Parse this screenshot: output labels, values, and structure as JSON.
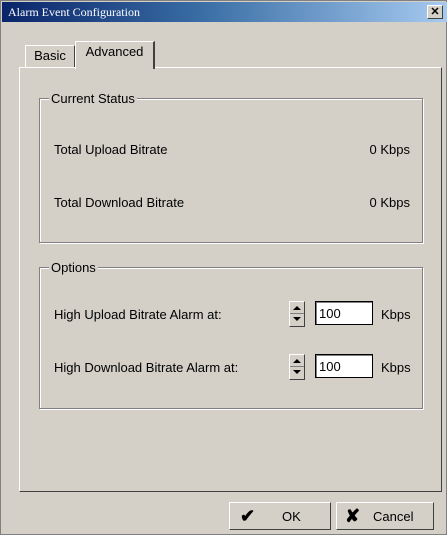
{
  "window": {
    "title": "Alarm Event Configuration",
    "close_glyph": "✕"
  },
  "tabs": [
    {
      "label": "Basic",
      "active": false
    },
    {
      "label": "Advanced",
      "active": true
    }
  ],
  "current_status": {
    "label": "Current Status",
    "rows": [
      {
        "label": "Total Upload Bitrate",
        "value": "0 Kbps"
      },
      {
        "label": "Total Download Bitrate",
        "value": "0 Kbps"
      }
    ]
  },
  "options": {
    "label": "Options",
    "rows": [
      {
        "label": "High Upload Bitrate Alarm at:",
        "value": "100",
        "unit": "Kbps"
      },
      {
        "label": "High Download Bitrate Alarm at:",
        "value": "100",
        "unit": "Kbps"
      }
    ]
  },
  "buttons": {
    "ok": {
      "label": "OK",
      "icon": "checkmark-icon",
      "glyph": "✔"
    },
    "cancel": {
      "label": "Cancel",
      "icon": "x-icon",
      "glyph": "✘"
    }
  },
  "colors": {
    "face": "#d4d0c8",
    "title_start": "#0a246a",
    "title_end": "#a6caf0"
  }
}
